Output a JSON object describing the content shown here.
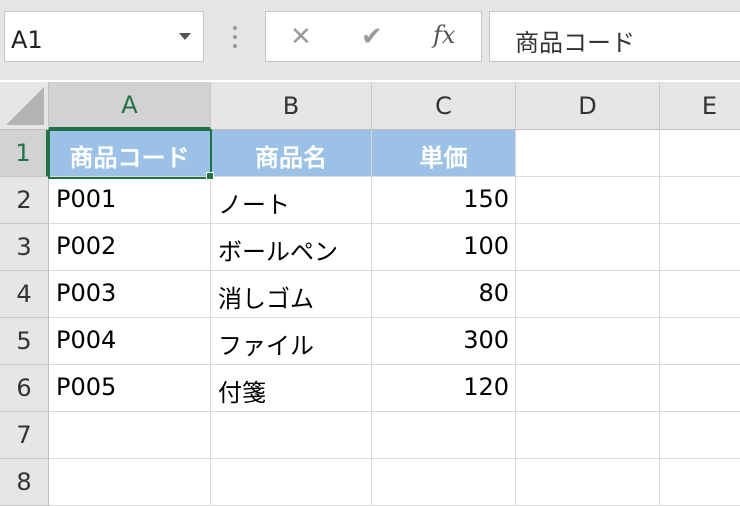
{
  "name_box": {
    "value": "A1"
  },
  "formula_bar": {
    "cancel_icon": "close-icon",
    "enter_icon": "check-icon",
    "fx_label": "fx",
    "content": "商品コード"
  },
  "columns": [
    "A",
    "B",
    "C",
    "D",
    "E"
  ],
  "rows": [
    "1",
    "2",
    "3",
    "4",
    "5",
    "6",
    "7",
    "8"
  ],
  "cells": [
    [
      "商品コード",
      "商品名",
      "単価",
      "",
      ""
    ],
    [
      "P001",
      "ノート",
      "150",
      "",
      ""
    ],
    [
      "P002",
      "ボールペン",
      "100",
      "",
      ""
    ],
    [
      "P003",
      "消しゴム",
      "80",
      "",
      ""
    ],
    [
      "P004",
      "ファイル",
      "300",
      "",
      ""
    ],
    [
      "P005",
      "付箋",
      "120",
      "",
      ""
    ],
    [
      "",
      "",
      "",
      "",
      ""
    ],
    [
      "",
      "",
      "",
      "",
      ""
    ]
  ],
  "selected_cell": "A1",
  "colors": {
    "header_fill": "#9bc2e6",
    "header_text": "#ffffff",
    "selection": "#217346",
    "chrome": "#e6e6e6"
  }
}
